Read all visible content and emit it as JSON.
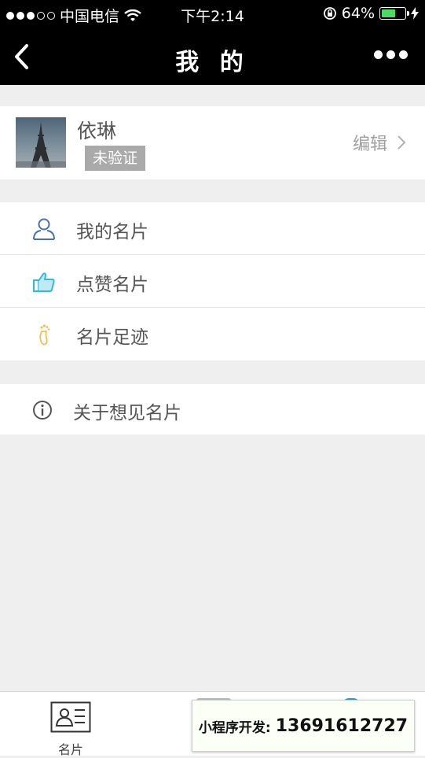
{
  "status_bar": {
    "carrier": "中国电信",
    "time": "下午2:14",
    "battery_percent": "64%",
    "battery_level": 0.64,
    "signal_dots_filled": 3,
    "signal_dots_total": 5
  },
  "nav": {
    "title": "我 的"
  },
  "profile": {
    "name": "依琳",
    "badge": "未验证",
    "edit_label": "编辑"
  },
  "menu": {
    "items": [
      {
        "label": "我的名片",
        "icon": "user-icon",
        "color": "#4a6fb5"
      },
      {
        "label": "点赞名片",
        "icon": "thumbs-up-icon",
        "color": "#36b7d6"
      },
      {
        "label": "名片足迹",
        "icon": "footprint-icon",
        "color": "#f2c14e"
      }
    ]
  },
  "about": {
    "label": "关于想见名片",
    "icon": "info-icon"
  },
  "tabbar": {
    "tab_label": "名片"
  },
  "promo": {
    "label": "小程序开发:",
    "phone": "13691612727"
  }
}
